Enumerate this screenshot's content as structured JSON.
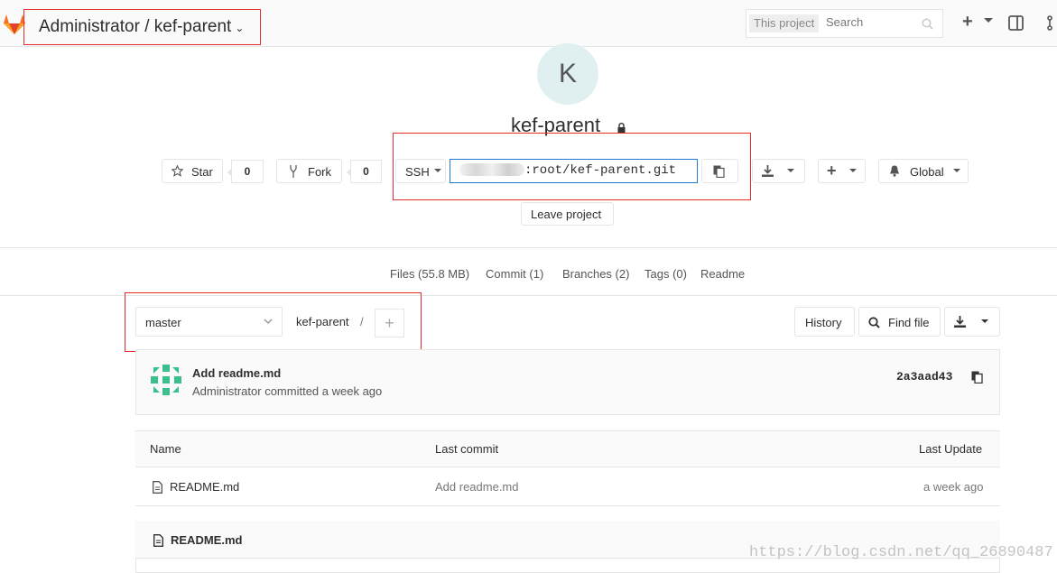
{
  "header": {
    "breadcrumb": "Administrator / kef-parent",
    "search_scope": "This project",
    "search_placeholder": "Search"
  },
  "project": {
    "avatar_letter": "K",
    "name": "kef-parent",
    "star_label": "Star",
    "star_count": "0",
    "fork_label": "Fork",
    "fork_count": "0",
    "protocol": "SSH",
    "clone_url_suffix": ":root/kef-parent.git",
    "notification_level": "Global",
    "leave_label": "Leave project"
  },
  "nav": {
    "files": "Files (55.8 MB)",
    "commit": "Commit (1)",
    "branches": "Branches (2)",
    "tags": "Tags (0)",
    "readme": "Readme"
  },
  "tree": {
    "branch": "master",
    "path": "kef-parent",
    "separator": "/",
    "history_label": "History",
    "find_file_label": "Find file"
  },
  "last_commit": {
    "title": "Add readme.md",
    "author_line": "Administrator committed a week ago",
    "sha": "2a3aad43"
  },
  "files_table": {
    "headers": [
      "Name",
      "Last commit",
      "Last Update"
    ],
    "rows": [
      {
        "name": "README.md",
        "commit": "Add readme.md",
        "updated": "a week ago"
      }
    ]
  },
  "readme": {
    "title": "README.md"
  },
  "watermark": "https://blog.csdn.net/qq_26890487",
  "colors": {
    "accent": "#1f78d1",
    "highlight_box": "#e52d2d"
  }
}
